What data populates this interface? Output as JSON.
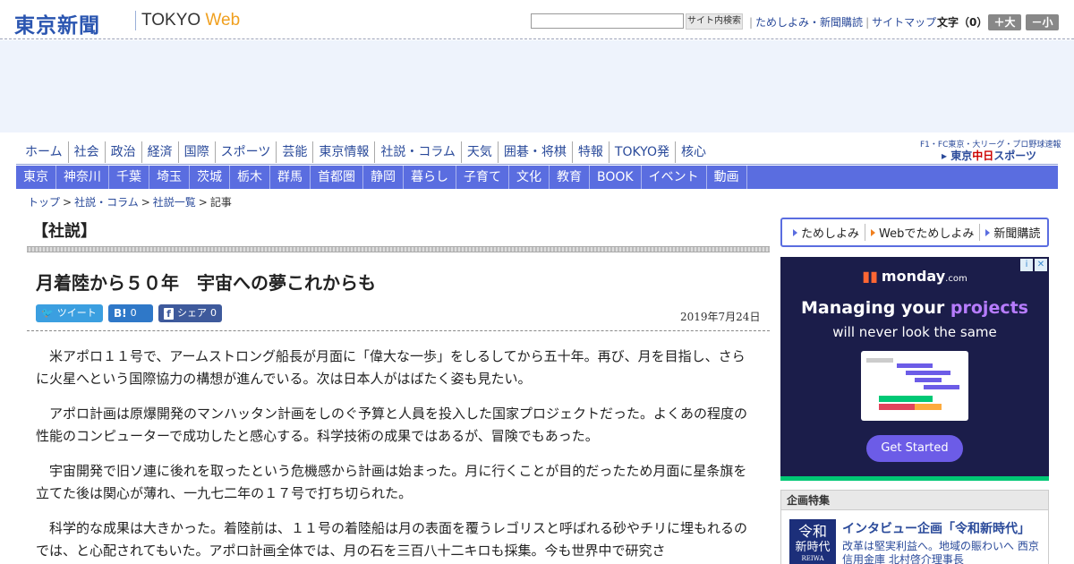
{
  "header": {
    "logo_jp": "東京新聞",
    "logo_en": "TOKYO",
    "logo_web": "Web",
    "search_button": "サイト内検索",
    "search_value": "",
    "links": [
      "ためしよみ・新聞購読",
      "サイトマップ"
    ],
    "fontsize_label": "文字（0）",
    "fontsize_plus": "＋大",
    "fontsize_minus": "－小"
  },
  "nav_primary": [
    "ホーム",
    "社会",
    "政治",
    "経済",
    "国際",
    "スポーツ",
    "芸能",
    "東京情報",
    "社説・コラム",
    "天気",
    "囲碁・将棋",
    "特報",
    "TOKYO発",
    "核心"
  ],
  "nav_sports": {
    "line1": "F1・FC東京・大リーグ・プロ野球速報",
    "prefix": "東京",
    "highlight": "中日",
    "suffix": "スポーツ"
  },
  "nav_secondary": [
    "東京",
    "神奈川",
    "千葉",
    "埼玉",
    "茨城",
    "栃木",
    "群馬",
    "首都圏",
    "静岡",
    "暮らし",
    "子育て",
    "文化",
    "教育",
    "BOOK",
    "イベント",
    "動画"
  ],
  "breadcrumb": [
    "トップ",
    "社説・コラム",
    "社説一覧",
    "記事"
  ],
  "article": {
    "section": "【社説】",
    "headline": "月着陸から５０年　宇宙への夢これからも",
    "date": "2019年7月24日",
    "share": {
      "tweet": "ツイート",
      "hatena_count": "0",
      "facebook": "シェア",
      "facebook_count": "0"
    },
    "paragraphs": [
      "米アポロ１１号で、アームストロング船長が月面に「偉大な一歩」をしるしてから五十年。再び、月を目指し、さらに火星へという国際協力の構想が進んでいる。次は日本人がはばたく姿も見たい。",
      "アポロ計画は原爆開発のマンハッタン計画をしのぐ予算と人員を投入した国家プロジェクトだった。よくあの程度の性能のコンピューターで成功したと感心する。科学技術の成果ではあるが、冒険でもあった。",
      "宇宙開発で旧ソ連に後れを取ったという危機感から計画は始まった。月に行くことが目的だったため月面に星条旗を立てた後は関心が薄れ、一九七二年の１７号で打ち切られた。",
      "科学的な成果は大きかった。着陸前は、１１号の着陸船は月の表面を覆うレゴリスと呼ばれる砂やチリに埋もれるのでは、と心配されてもいた。アポロ計画全体では、月の石を三百八十二キロも採集。今も世界中で研究さ"
    ]
  },
  "sidebar": {
    "links": [
      "ためしよみ",
      "Webでためしよみ",
      "新聞購読"
    ],
    "ad": {
      "brand": "monday",
      "brand_suffix": ".com",
      "headline_pre": "Managing your ",
      "headline_hl": "projects",
      "subline": "will never look the same",
      "button": "Get Started",
      "accent": "#6c5ce7"
    },
    "feature": {
      "title": "企画特集",
      "thumb_line1": "令和",
      "thumb_line2": "新時代",
      "thumb_line3": "REIWA",
      "headline": "インタビュー企画「令和新時代」",
      "desc": "改革は堅実利益へ。地域の賑わいへ 西京信用金庫 北村啓介理事長"
    }
  },
  "colors": {
    "brand_blue": "#2a55b0",
    "nav_blue": "#5a6de0",
    "link": "#2a4a9a"
  }
}
